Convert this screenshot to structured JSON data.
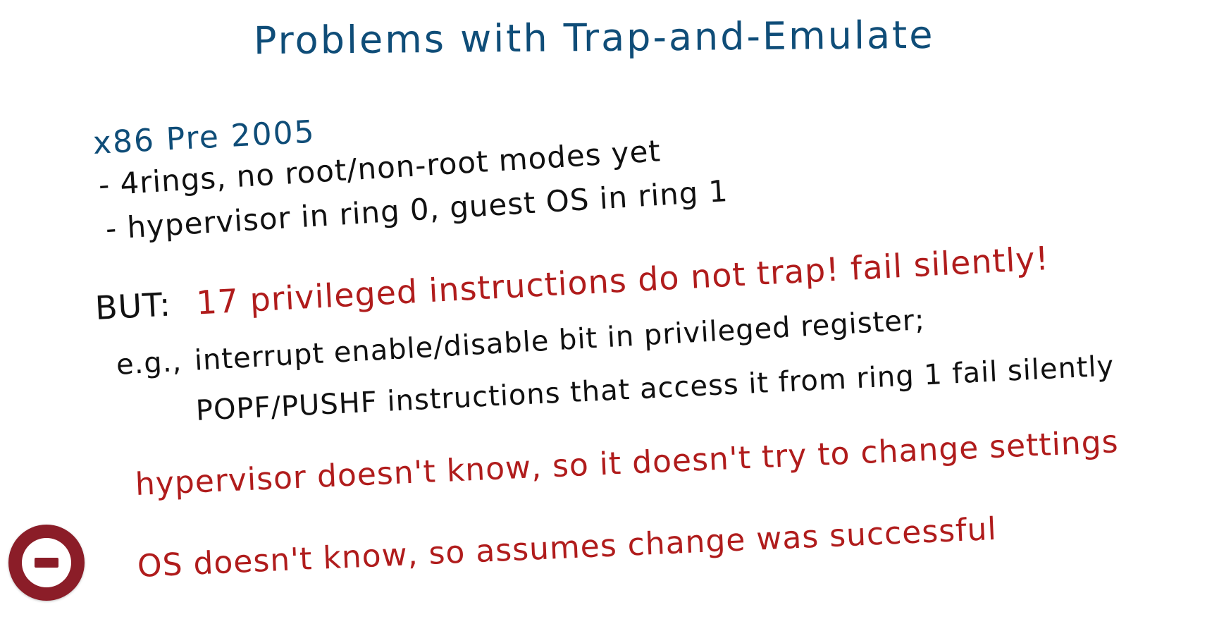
{
  "slide": {
    "title": "Problems with Trap-and-Emulate",
    "subtitle": "x86 Pre 2005",
    "bullets": [
      "- 4rings, no root/non-root modes yet",
      "- hypervisor in ring 0, guest OS in ring 1"
    ],
    "but_label": "BUT:",
    "but_text": "17 privileged instructions do not trap! fail silently!",
    "example_prefix": "e.g.,",
    "example_line1": "interrupt enable/disable bit in privileged register;",
    "example_line2": "POPF/PUSHF instructions that access it from ring 1 fail silently",
    "consequence_1": "hypervisor doesn't know, so it doesn't try to change settings",
    "consequence_2": "OS doesn't know, so assumes change was successful"
  },
  "controls": {
    "stop_icon": "minus-circle-icon",
    "accent_color": "#8b1d28"
  },
  "colors": {
    "blue_ink": "#0f4d78",
    "black_ink": "#111111",
    "red_ink": "#b01c1c"
  }
}
